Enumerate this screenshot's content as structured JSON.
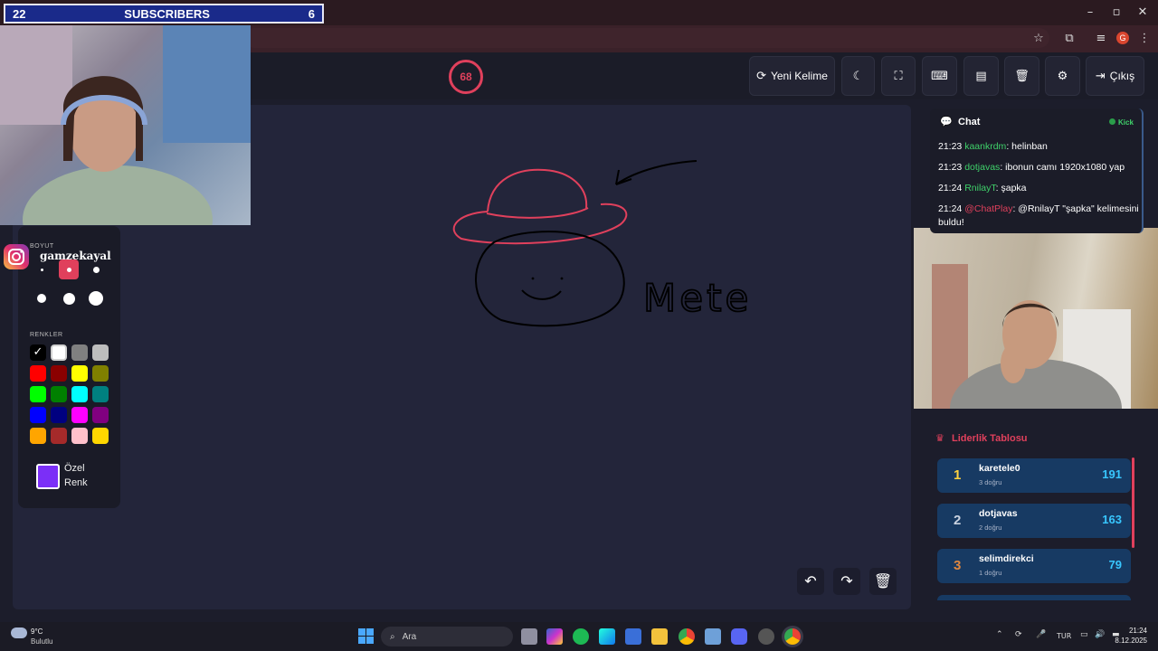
{
  "overlay": {
    "subs_left": "22",
    "subs_label": "SUBSCRIBERS",
    "subs_right": "6",
    "instagram_handle": "gamzekayal"
  },
  "header": {
    "timer": "68",
    "new_word_label": "Yeni Kelime",
    "exit_label": "Çıkış"
  },
  "canvas": {
    "drawn_word": "Mete",
    "stroke_colors": [
      "#e0405c",
      "#000000"
    ]
  },
  "tools": {
    "size_label": "BOYUT",
    "colors_label": "RENKLER",
    "custom_color_label": "Özel Renk",
    "custom_color": "#7b2ff7",
    "palette": [
      [
        "#000000",
        "#ffffff",
        "#808080",
        "#bdbdbd"
      ],
      [
        "#ff0000",
        "#8b0000",
        "#ffff00",
        "#808000"
      ],
      [
        "#00ff00",
        "#008000",
        "#00ffff",
        "#008080"
      ],
      [
        "#0000ff",
        "#000080",
        "#ff00ff",
        "#800080"
      ],
      [
        "#ffa500",
        "#a52a2a",
        "#ffc0cb",
        "#ffd700"
      ]
    ]
  },
  "chat": {
    "title": "Chat",
    "platform": "Kick",
    "messages": [
      {
        "time": "21:23",
        "user": "kaankrdm",
        "user_color": "#3fd16a",
        "text": ": helinban"
      },
      {
        "time": "21:23",
        "user": "dotjavas",
        "user_color": "#3fd16a",
        "text": ": ibonun camı 1920x1080 yap"
      },
      {
        "time": "21:24",
        "user": "RnilayT",
        "user_color": "#3fd16a",
        "text": ": şapka"
      },
      {
        "time": "21:24",
        "user": "@ChatPlay",
        "user_color": "#e0405c",
        "text": ": @RnilayT \"şapka\" kelimesini buldu!"
      }
    ]
  },
  "leaderboard": {
    "title": "Liderlik Tablosu",
    "rows": [
      {
        "rank": "1",
        "rank_color": "#ffd23f",
        "name": "karetele0",
        "sub": "3 doğru",
        "score": "191"
      },
      {
        "rank": "2",
        "rank_color": "#c9d2e0",
        "name": "dotjavas",
        "sub": "2 doğru",
        "score": "163"
      },
      {
        "rank": "3",
        "rank_color": "#e0873f",
        "name": "selimdirekci",
        "sub": "1 doğru",
        "score": "79"
      }
    ]
  },
  "taskbar": {
    "weather_temp": "9°C",
    "weather_desc": "Bulutlu",
    "search_placeholder": "Ara",
    "language": "TUR",
    "time": "21:24",
    "date": "8.12.2025"
  }
}
